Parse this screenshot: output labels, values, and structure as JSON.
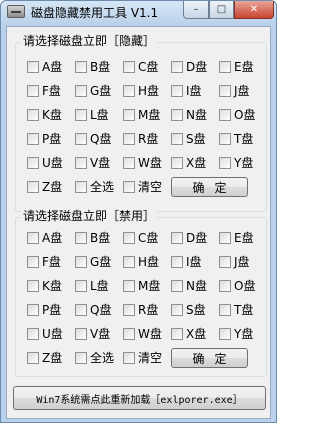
{
  "window": {
    "title": "磁盘隐藏禁用工具 V1.1",
    "controls": {
      "minimize": "–",
      "maximize": "□",
      "close": "✕"
    }
  },
  "hide_group": {
    "title": "请选择磁盘立即［隐藏］",
    "drives": [
      "A盘",
      "B盘",
      "C盘",
      "D盘",
      "E盘",
      "F盘",
      "G盘",
      "H盘",
      "I盘",
      "J盘",
      "K盘",
      "L盘",
      "M盘",
      "N盘",
      "O盘",
      "P盘",
      "Q盘",
      "R盘",
      "S盘",
      "T盘",
      "U盘",
      "V盘",
      "W盘",
      "X盘",
      "Y盘"
    ],
    "last_drive": "Z盘",
    "select_all": "全选",
    "clear": "清空",
    "confirm": "确定"
  },
  "disable_group": {
    "title": "请选择磁盘立即［禁用］",
    "drives": [
      "A盘",
      "B盘",
      "C盘",
      "D盘",
      "E盘",
      "F盘",
      "G盘",
      "H盘",
      "I盘",
      "J盘",
      "K盘",
      "L盘",
      "M盘",
      "N盘",
      "O盘",
      "P盘",
      "Q盘",
      "R盘",
      "S盘",
      "T盘",
      "U盘",
      "V盘",
      "W盘",
      "X盘",
      "Y盘"
    ],
    "last_drive": "Z盘",
    "select_all": "全选",
    "clear": "清空",
    "confirm": "确定"
  },
  "reload_button": "Win7系统需点此重新加载［exlporer.exe］",
  "icons": {
    "app": "disk-drive-icon"
  }
}
